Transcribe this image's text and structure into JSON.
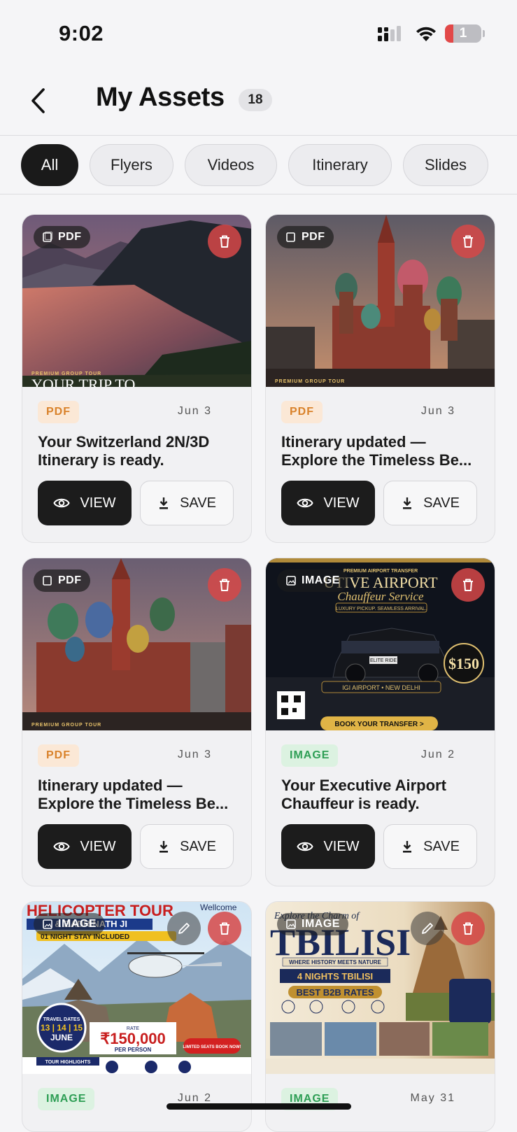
{
  "status_bar": {
    "time": "9:02",
    "battery_level": "1"
  },
  "header": {
    "title": "My Assets",
    "count": "18"
  },
  "filters": [
    {
      "label": "All",
      "active": true
    },
    {
      "label": "Flyers",
      "active": false
    },
    {
      "label": "Videos",
      "active": false
    },
    {
      "label": "Itinerary",
      "active": false
    },
    {
      "label": "Slides",
      "active": false
    }
  ],
  "cards": [
    {
      "thumb_type": "PDF",
      "badge": "PDF",
      "date": "Jun 3",
      "title": "Your Switzerland 2N/3D Itinerary is ready.",
      "view_label": "VIEW",
      "save_label": "SAVE",
      "thumb_text": "PREMIUM GROUP TOUR",
      "thumb_text2": "YOUR TRIP TO"
    },
    {
      "thumb_type": "PDF",
      "badge": "PDF",
      "date": "Jun 3",
      "title": "Itinerary updated — Explore the Timeless Be...",
      "view_label": "VIEW",
      "save_label": "SAVE",
      "thumb_text": "PREMIUM GROUP TOUR"
    },
    {
      "thumb_type": "PDF",
      "badge": "PDF",
      "date": "Jun 3",
      "title": "Itinerary updated — Explore the Timeless Be...",
      "view_label": "VIEW",
      "save_label": "SAVE",
      "thumb_text": "PREMIUM GROUP TOUR"
    },
    {
      "thumb_type": "IMAGE",
      "badge": "IMAGE",
      "date": "Jun 2",
      "title": "Your Executive Airport Chauffeur is ready.",
      "view_label": "VIEW",
      "save_label": "SAVE",
      "thumb_text": "PREMIUM AIRPORT TRANSFER",
      "thumb_heading": "UTIVE AIRPORT",
      "thumb_script": "Chauffeur Service",
      "thumb_sub": "LUXURY PICKUP. SEAMLESS ARRIVAL.",
      "thumb_location": "IGI AIRPORT • NEW DELHI",
      "thumb_price": "$150",
      "thumb_cta": "BOOK YOUR TRANSFER >",
      "thumb_plate": "ELITE RIDE"
    },
    {
      "thumb_type": "IMAGE",
      "badge": "IMAGE",
      "date": "Jun 2",
      "title": "",
      "view_label": "VIEW",
      "save_label": "SAVE",
      "thumb_heading": "HELICOPTER TOUR",
      "thumb_sub": "& BADRINATH JI",
      "thumb_stay": "01 NIGHT STAY INCLUDED",
      "thumb_welcome": "Wellcome",
      "thumb_dates_label": "TRAVEL DATES",
      "thumb_dates": "13 | 14 | 15",
      "thumb_month": "JUNE",
      "thumb_rate_label": "RATE",
      "thumb_price": "₹150,000",
      "thumb_per": "PER PERSON",
      "thumb_seats": "LIMITED SEATS BOOK NOW!",
      "thumb_highlights": "TOUR HIGHLIGHTS"
    },
    {
      "thumb_type": "IMAGE",
      "badge": "IMAGE",
      "date": "May 31",
      "title": "",
      "view_label": "VIEW",
      "save_label": "SAVE",
      "thumb_script": "Explore the Charm of",
      "thumb_heading": "TBILISI",
      "thumb_sub": "WHERE HISTORY MEETS NATURE",
      "thumb_nights": "4 NIGHTS TBILISI",
      "thumb_rates": "BEST B2B RATES"
    }
  ],
  "colors": {
    "accent_dark": "#1c1c1c",
    "delete": "#d64848",
    "pdf": "#d9822b",
    "image": "#2e9e55"
  }
}
